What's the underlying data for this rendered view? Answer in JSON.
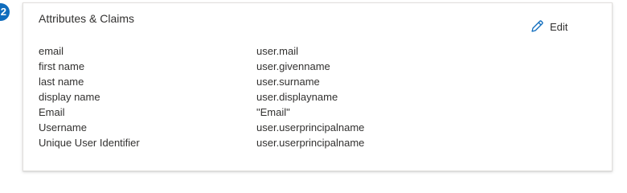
{
  "step": {
    "number": "2"
  },
  "card": {
    "title": "Attributes & Claims",
    "edit_label": "Edit"
  },
  "claims": [
    {
      "name": "email",
      "value": "user.mail"
    },
    {
      "name": "first name",
      "value": "user.givenname"
    },
    {
      "name": "last name",
      "value": "user.surname"
    },
    {
      "name": "display name",
      "value": "user.displayname"
    },
    {
      "name": "Email",
      "value": "\"Email\""
    },
    {
      "name": "Username",
      "value": "user.userprincipalname"
    },
    {
      "name": "Unique User Identifier",
      "value": "user.userprincipalname"
    }
  ],
  "icons": {
    "edit": "pencil-icon"
  },
  "colors": {
    "accent": "#0f6cbd",
    "text": "#323130",
    "border": "#e1dfdd"
  }
}
